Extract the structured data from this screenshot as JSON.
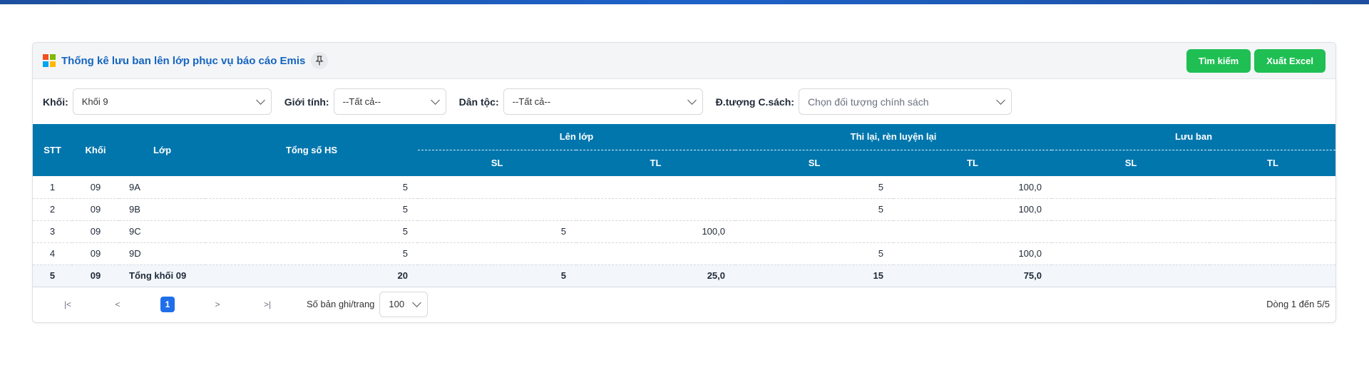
{
  "header": {
    "title": "Thống kê lưu ban lên lớp phục vụ báo cáo Emis",
    "pin_icon": "pin-icon",
    "logo_colors": [
      "#f25022",
      "#7fba00",
      "#00a4ef",
      "#ffb900"
    ],
    "buttons": {
      "search": "Tìm kiếm",
      "export": "Xuất Excel"
    },
    "accent_color": "#1fbf53"
  },
  "filters": {
    "grade": {
      "label": "Khối:",
      "value": "Khối 9"
    },
    "gender": {
      "label": "Giới tính:",
      "value": "--Tất cả--"
    },
    "ethnicity": {
      "label": "Dân tộc:",
      "value": "--Tất cả--"
    },
    "policy": {
      "label": "Đ.tượng C.sách:",
      "placeholder": "Chọn đối tượng chính sách"
    }
  },
  "table": {
    "header_color": "#0076ad",
    "columns": {
      "stt": "STT",
      "grade": "Khối",
      "class": "Lớp",
      "total": "Tổng số HS",
      "promoted": "Lên lớp",
      "retest": "Thi lại, rèn luyện lại",
      "retained": "Lưu ban",
      "sl": "SL",
      "tl": "TL"
    },
    "rows": [
      {
        "stt": "1",
        "grade": "09",
        "class": "9A",
        "total": "5",
        "up_sl": "",
        "up_tl": "",
        "re_sl": "5",
        "re_tl": "100,0",
        "lb_sl": "",
        "lb_tl": ""
      },
      {
        "stt": "2",
        "grade": "09",
        "class": "9B",
        "total": "5",
        "up_sl": "",
        "up_tl": "",
        "re_sl": "5",
        "re_tl": "100,0",
        "lb_sl": "",
        "lb_tl": ""
      },
      {
        "stt": "3",
        "grade": "09",
        "class": "9C",
        "total": "5",
        "up_sl": "5",
        "up_tl": "100,0",
        "re_sl": "",
        "re_tl": "",
        "lb_sl": "",
        "lb_tl": ""
      },
      {
        "stt": "4",
        "grade": "09",
        "class": "9D",
        "total": "5",
        "up_sl": "",
        "up_tl": "",
        "re_sl": "5",
        "re_tl": "100,0",
        "lb_sl": "",
        "lb_tl": ""
      }
    ],
    "total_row": {
      "stt": "5",
      "grade": "09",
      "class": "Tổng khối 09",
      "total": "20",
      "up_sl": "5",
      "up_tl": "25,0",
      "re_sl": "15",
      "re_tl": "75,0",
      "lb_sl": "",
      "lb_tl": ""
    }
  },
  "pager": {
    "first": "|<",
    "prev": "<",
    "current": "1",
    "next": ">",
    "last": ">|",
    "per_page_label": "Số bản ghi/trang",
    "per_page_value": "100",
    "record_info": "Dòng 1 đến 5/5"
  }
}
